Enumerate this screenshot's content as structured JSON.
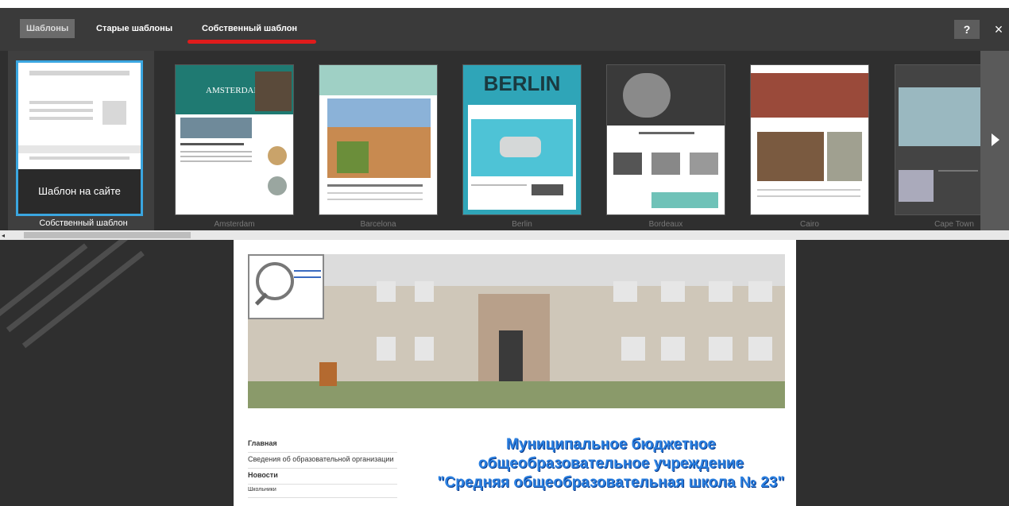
{
  "header": {
    "tabs": [
      {
        "label": "Шаблоны",
        "active": true
      },
      {
        "label": "Старые шаблоны",
        "active": false
      },
      {
        "label": "Собственный шаблон",
        "active": false
      }
    ],
    "help_label": "?",
    "close_label": "×",
    "underline_color": "#e01b1b"
  },
  "gallery": {
    "own_template": {
      "footer_text": "Шаблон на сайте",
      "label": "Собственный шаблон",
      "border_color": "#3aa6e0"
    },
    "templates": [
      {
        "name": "Amsterdam",
        "preview_title": "AMSTERDAM"
      },
      {
        "name": "Barcelona",
        "preview_title": ""
      },
      {
        "name": "Berlin",
        "preview_title": "BERLIN"
      },
      {
        "name": "Bordeaux",
        "preview_title": ""
      },
      {
        "name": "Cairo",
        "preview_title": ""
      },
      {
        "name": "Cape Town",
        "preview_title": ""
      }
    ],
    "next_icon": "chevron-right-icon"
  },
  "scrollbar": {
    "left_icon": "scroll-left-arrow-icon"
  },
  "preview": {
    "menu": [
      {
        "label": "Главная",
        "bold": true
      },
      {
        "label": "Сведения об образовательной организации",
        "bold": false
      },
      {
        "label": "Новости",
        "bold": true
      },
      {
        "label": "Школьники",
        "bold": false
      }
    ],
    "school_title_lines": [
      "Муниципальное бюджетное",
      "общеобразовательное учреждение",
      "\"Средняя общеобразовательная школа № 23\""
    ]
  }
}
